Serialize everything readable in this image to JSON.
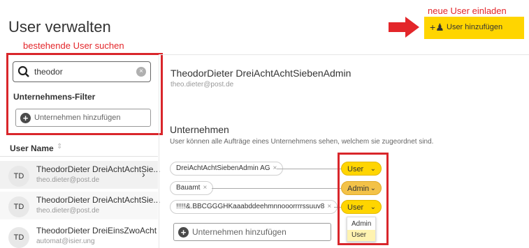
{
  "page": {
    "title": "User verwalten"
  },
  "annotations": {
    "invite": "neue User einladen",
    "search": "bestehende User suchen"
  },
  "header": {
    "invite_button_label": "User hinzufügen",
    "invite_icon": "add-user-icon"
  },
  "search": {
    "value": "theodor",
    "icon": "search-icon"
  },
  "filter": {
    "label": "Unternehmens-Filter",
    "add_label": "Unternehmen hinzufügen"
  },
  "user_list": {
    "column_header": "User Name",
    "rows": [
      {
        "initials": "TD",
        "name": "TheodorDieter DreiAchtAchtSie...",
        "email": "theo.dieter@post.de",
        "selected": true
      },
      {
        "initials": "TD",
        "name": "TheodorDieter DreiAchtAchtSie...",
        "email": "theo.dieter@post.de",
        "selected": false
      },
      {
        "initials": "TD",
        "name": "TheodorDieter DreiEinsZwoAcht",
        "email": "automat@isier.ung",
        "selected": false
      }
    ]
  },
  "detail": {
    "name": "TheodorDieter DreiAchtAchtSiebenAdmin",
    "email": "theo.dieter@post.de",
    "companies_title": "Unternehmen",
    "companies_desc": "User können alle Aufträge eines Unternehmens sehen, welchem sie zugeordnet sind.",
    "companies": [
      {
        "name": "DreiAchtAchtSiebenAdmin AG",
        "role": "User"
      },
      {
        "name": "Bauamt",
        "role": "Admin"
      },
      {
        "name": "!!!!!&.BBCGGGHKaaabddeehmnnooorrrrssuuv8",
        "role": "User"
      }
    ],
    "add_company_label": "Unternehmen hinzufügen",
    "role_options": [
      "Admin",
      "User"
    ],
    "role_selected": "User"
  },
  "colors": {
    "accent": "#ffd500",
    "highlight": "#d9262b"
  }
}
